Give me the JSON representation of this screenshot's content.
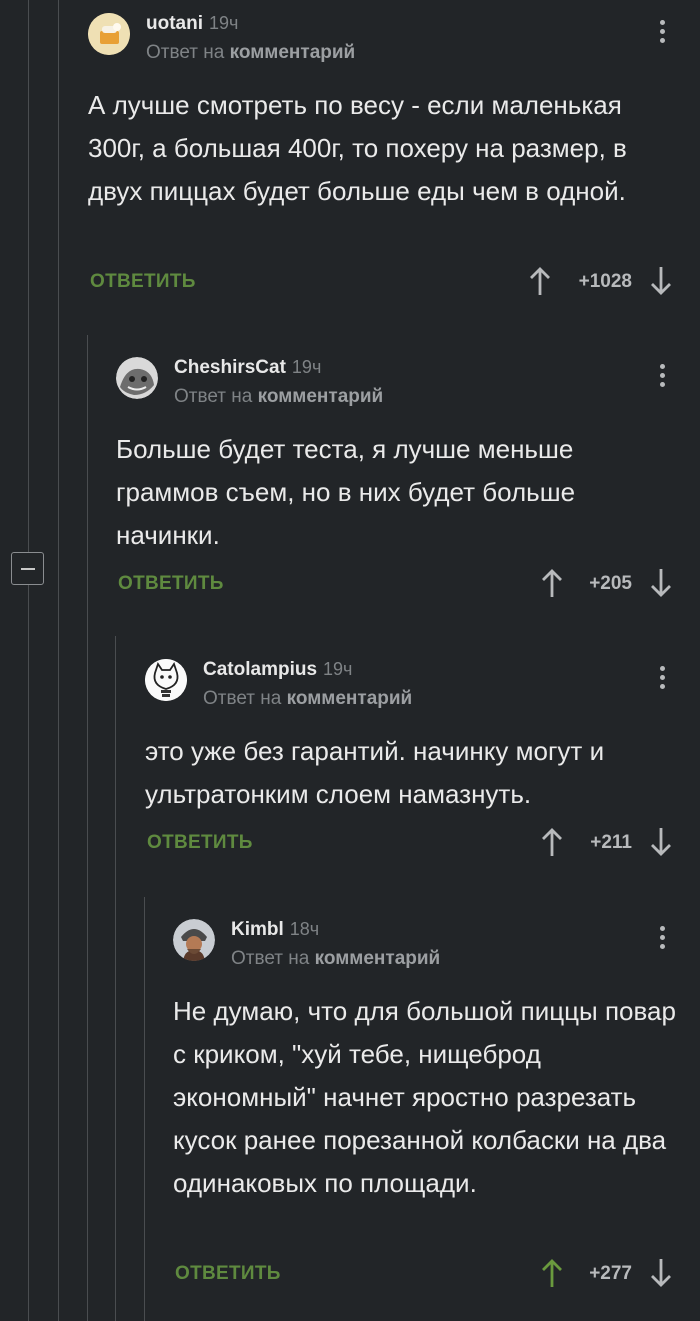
{
  "comments": [
    {
      "username": "uotani",
      "time": "19ч",
      "reply_prefix": "Ответ на",
      "reply_link": "комментарий",
      "text": "А лучше смотреть по весу - если маленькая 300г, а большая 400г, то похеру на размер, в двух пиццах будет больше еды чем в одной.",
      "reply_action": "ОТВЕТИТЬ",
      "score": "+1028",
      "upvoted": false
    },
    {
      "username": "CheshirsCat",
      "time": "19ч",
      "reply_prefix": "Ответ на",
      "reply_link": "комментарий",
      "text": "Больше будет теста, я лучше меньше граммов съем, но в них будет больше начинки.",
      "reply_action": "ОТВЕТИТЬ",
      "score": "+205",
      "upvoted": false
    },
    {
      "username": "Catolampius",
      "time": "19ч",
      "reply_prefix": "Ответ на",
      "reply_link": "комментарий",
      "text": "это уже без гарантий. начинку могут и ультратонким слоем намазнуть.",
      "reply_action": "ОТВЕТИТЬ",
      "score": "+211",
      "upvoted": false
    },
    {
      "username": "Kimbl",
      "time": "18ч",
      "reply_prefix": "Ответ на",
      "reply_link": "комментарий",
      "text": "Не думаю, что для большой пиццы повар с криком, \"хуй тебе, нищеброд экономный\" начнет яростно разрезать кусок ранее порезанной колбаски на два одинаковых по площади.",
      "reply_action": "ОТВЕТИТЬ",
      "score": "+277",
      "upvoted": true
    }
  ],
  "colors": {
    "background": "#222528",
    "action_green": "#5f8a3f",
    "upvote_active": "#6a9a3e",
    "muted_text": "#7f8386"
  },
  "icons": [
    "avatar-uotani",
    "avatar-cheshirscat",
    "avatar-catolampius",
    "avatar-kimbl",
    "more-menu-icon",
    "upvote-arrow-icon",
    "downvote-arrow-icon",
    "collapse-thread-icon"
  ]
}
